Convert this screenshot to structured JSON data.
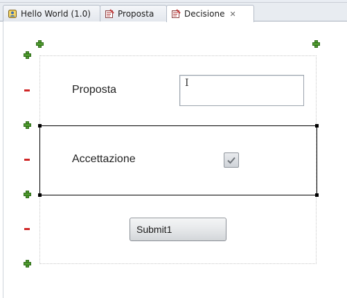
{
  "tabs": [
    {
      "label": "Hello World (1.0)",
      "icon": "process-model-icon",
      "active": false
    },
    {
      "label": "Proposta",
      "icon": "form-icon",
      "active": false
    },
    {
      "label": "Decisione",
      "icon": "form-icon",
      "active": true,
      "close_icon": "✕"
    }
  ],
  "form": {
    "rows": [
      {
        "label": "Proposta",
        "widget": "text-field",
        "value": "",
        "caret": "I"
      },
      {
        "label": "Accettazione",
        "widget": "checkbox",
        "checked": true,
        "check_glyph": "✓"
      },
      {
        "label": "",
        "widget": "button",
        "button_label": "Submit1"
      }
    ],
    "markers": {
      "plus": "+",
      "minus": "−"
    }
  },
  "colors": {
    "plus": "#4f9a2f",
    "minus": "#d02626",
    "selection_border": "#000000",
    "tab_background": "#e8ecf1"
  }
}
